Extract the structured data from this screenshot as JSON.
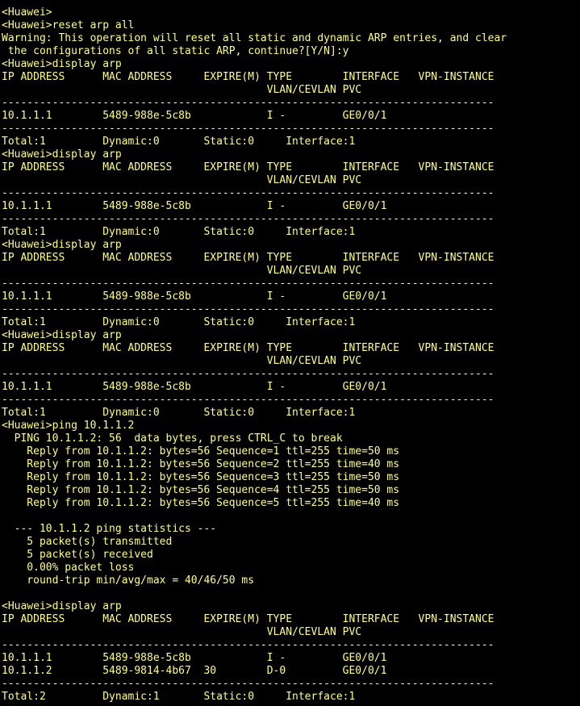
{
  "terminal": {
    "lines": [
      "<Huawei>",
      "<Huawei>reset arp all",
      "Warning: This operation will reset all static and dynamic ARP entries, and clear",
      " the configurations of all static ARP, continue?[Y/N]:y",
      "<Huawei>display arp",
      "IP ADDRESS      MAC ADDRESS     EXPIRE(M) TYPE        INTERFACE   VPN-INSTANCE",
      "                                          VLAN/CEVLAN PVC",
      "------------------------------------------------------------------------------",
      "10.1.1.1        5489-988e-5c8b            I -         GE0/0/1",
      "------------------------------------------------------------------------------",
      "Total:1         Dynamic:0       Static:0     Interface:1",
      "<Huawei>display arp",
      "IP ADDRESS      MAC ADDRESS     EXPIRE(M) TYPE        INTERFACE   VPN-INSTANCE",
      "                                          VLAN/CEVLAN PVC",
      "------------------------------------------------------------------------------",
      "10.1.1.1        5489-988e-5c8b            I -         GE0/0/1",
      "------------------------------------------------------------------------------",
      "Total:1         Dynamic:0       Static:0     Interface:1",
      "<Huawei>display arp",
      "IP ADDRESS      MAC ADDRESS     EXPIRE(M) TYPE        INTERFACE   VPN-INSTANCE",
      "                                          VLAN/CEVLAN PVC",
      "------------------------------------------------------------------------------",
      "10.1.1.1        5489-988e-5c8b            I -         GE0/0/1",
      "------------------------------------------------------------------------------",
      "Total:1         Dynamic:0       Static:0     Interface:1",
      "<Huawei>display arp",
      "IP ADDRESS      MAC ADDRESS     EXPIRE(M) TYPE        INTERFACE   VPN-INSTANCE",
      "                                          VLAN/CEVLAN PVC",
      "------------------------------------------------------------------------------",
      "10.1.1.1        5489-988e-5c8b            I -         GE0/0/1",
      "------------------------------------------------------------------------------",
      "Total:1         Dynamic:0       Static:0     Interface:1",
      "<Huawei>ping 10.1.1.2",
      "  PING 10.1.1.2: 56  data bytes, press CTRL_C to break",
      "    Reply from 10.1.1.2: bytes=56 Sequence=1 ttl=255 time=50 ms",
      "    Reply from 10.1.1.2: bytes=56 Sequence=2 ttl=255 time=40 ms",
      "    Reply from 10.1.1.2: bytes=56 Sequence=3 ttl=255 time=50 ms",
      "    Reply from 10.1.1.2: bytes=56 Sequence=4 ttl=255 time=50 ms",
      "    Reply from 10.1.1.2: bytes=56 Sequence=5 ttl=255 time=40 ms",
      "",
      "  --- 10.1.1.2 ping statistics ---",
      "    5 packet(s) transmitted",
      "    5 packet(s) received",
      "    0.00% packet loss",
      "    round-trip min/avg/max = 40/46/50 ms",
      "",
      "<Huawei>display arp",
      "IP ADDRESS      MAC ADDRESS     EXPIRE(M) TYPE        INTERFACE   VPN-INSTANCE",
      "                                          VLAN/CEVLAN PVC",
      "------------------------------------------------------------------------------",
      "10.1.1.1        5489-988e-5c8b            I -         GE0/0/1",
      "10.1.1.2        5489-9814-4b67  30        D-0         GE0/0/1",
      "------------------------------------------------------------------------------",
      "Total:2         Dynamic:1       Static:0     Interface:1"
    ]
  },
  "colors": {
    "background": "#000000",
    "text": "#ffff84"
  }
}
